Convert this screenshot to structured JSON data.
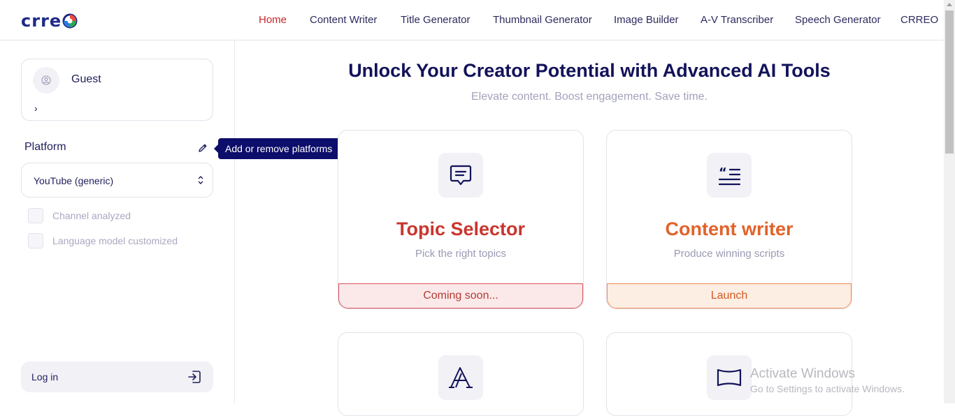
{
  "brand": {
    "logo_text": "crre"
  },
  "nav": {
    "items": [
      {
        "label": "Home",
        "active": true
      },
      {
        "label": "Content Writer"
      },
      {
        "label": "Title Generator"
      },
      {
        "label": "Thumbnail Generator"
      },
      {
        "label": "Image Builder"
      },
      {
        "label": "A-V Transcriber"
      },
      {
        "label": "Speech Generator"
      },
      {
        "label": "CRREO"
      }
    ]
  },
  "sidebar": {
    "user": {
      "name": "Guest",
      "chevron": "›"
    },
    "platform_label": "Platform",
    "platform_tooltip": "Add or remove platforms",
    "platform_selected": "YouTube (generic)",
    "checks": [
      {
        "label": "Channel analyzed",
        "checked": false
      },
      {
        "label": "Language model customized",
        "checked": false
      }
    ],
    "login_label": "Log in"
  },
  "hero": {
    "title": "Unlock Your Creator Potential with Advanced AI Tools",
    "subtitle": "Elevate content. Boost engagement. Save time."
  },
  "cards": [
    {
      "icon": "chat-bubble-icon",
      "title": "Topic Selector",
      "subtitle": "Pick the right topics",
      "action": "Coming soon...",
      "accent": "#c8362e"
    },
    {
      "icon": "quote-lines-icon",
      "title": "Content writer",
      "subtitle": "Produce winning scripts",
      "action": "Launch",
      "accent": "#e2622a"
    },
    {
      "icon": "letter-a-icon"
    },
    {
      "icon": "banner-icon"
    }
  ],
  "watermark": {
    "line1": "Activate Windows",
    "line2": "Go to Settings to activate Windows."
  },
  "colors": {
    "brand_navy": "#12125a",
    "active_nav": "#c8262a",
    "tooltip_bg": "#0d0d6b"
  }
}
